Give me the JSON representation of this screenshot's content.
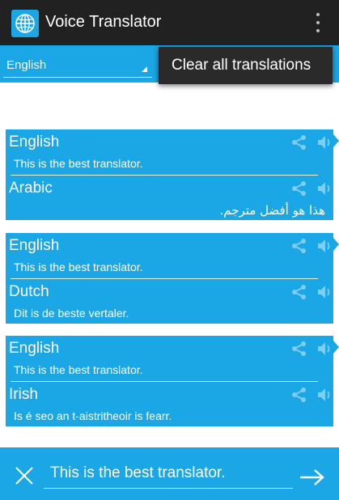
{
  "app": {
    "title": "Voice Translator"
  },
  "language_selector": {
    "selected": "English"
  },
  "overflow_menu": {
    "items": [
      "Clear all translations"
    ]
  },
  "translations": [
    {
      "source_lang": "English",
      "source_text": "This is the best translator.",
      "target_lang": "Arabic",
      "target_text": "هذا هو أفضل مترجم."
    },
    {
      "source_lang": "English",
      "source_text": "This is the best translator.",
      "target_lang": "Dutch",
      "target_text": "Dit is de beste vertaler."
    },
    {
      "source_lang": "English",
      "source_text": "This is the best translator.",
      "target_lang": "Irish",
      "target_text": "Is é seo an t-aistritheoir is fearr."
    }
  ],
  "input": {
    "value": "This is the best translator."
  },
  "icons": {
    "share": "share-icon",
    "speaker": "speaker-icon",
    "close": "close-icon",
    "send": "arrow-right-icon",
    "app": "globe-icon",
    "overflow": "more-vert-icon"
  },
  "colors": {
    "accent": "#1ba6e6",
    "action_bar": "#212121",
    "popup": "#2a2a2a"
  }
}
